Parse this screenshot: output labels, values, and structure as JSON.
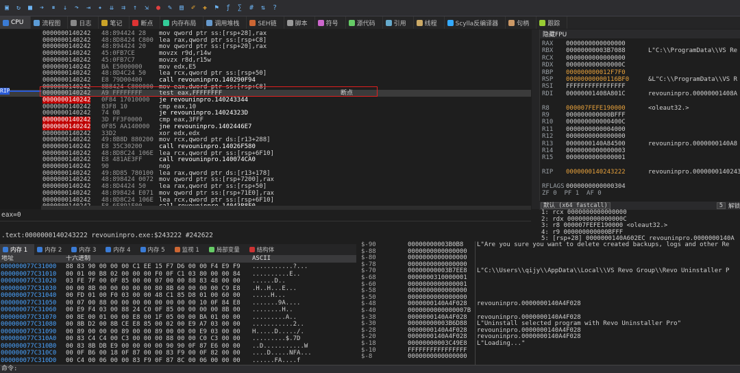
{
  "toolbar": {
    "icons": [
      "open-icon",
      "restart-icon",
      "close-icon",
      "run-icon",
      "pause-icon",
      "step-into-icon",
      "step-over-icon",
      "run-to-user-icon",
      "animate-icon",
      "trace-into-icon",
      "trace-over-icon",
      "step-out-icon",
      "run-to-selection-icon",
      "breakpoint-icon",
      "patch-icon",
      "memory-icon",
      "comment-icon",
      "label-icon",
      "bookmark-icon",
      "function-icon",
      "calc-icon",
      "hash-icon",
      "sort-icon",
      "help-icon"
    ]
  },
  "tabs": [
    {
      "label": "CPU",
      "color": "#3a7bd5"
    },
    {
      "label": "流程图",
      "color": "#5b9bd5"
    },
    {
      "label": "日志",
      "color": "#888"
    },
    {
      "label": "笔记",
      "color": "#c9a227"
    },
    {
      "label": "断点",
      "color": "#d33"
    },
    {
      "label": "内存布局",
      "color": "#3c9"
    },
    {
      "label": "调用堆栈",
      "color": "#69c"
    },
    {
      "label": "SEH链",
      "color": "#c63"
    },
    {
      "label": "脚本",
      "color": "#999"
    },
    {
      "label": "符号",
      "color": "#c6c"
    },
    {
      "label": "源代码",
      "color": "#6c6"
    },
    {
      "label": "引用",
      "color": "#6ac"
    },
    {
      "label": "线程",
      "color": "#ca6"
    },
    {
      "label": "Scylla反编译器",
      "color": "#3af"
    },
    {
      "label": "句柄",
      "color": "#c96"
    },
    {
      "label": "跟踪",
      "color": "#9c3"
    }
  ],
  "cpu": {
    "rows": [
      {
        "addr": "0000000140242",
        "bytes": "48:894424 28",
        "ins": "mov qword ptr ss:[rsp+28],rax",
        "com": ""
      },
      {
        "addr": "0000000140242",
        "bytes": "48:8D8424 C800",
        "ins": "lea rax,qword ptr ss:[rsp+C8]",
        "com": ""
      },
      {
        "addr": "0000000140242",
        "bytes": "48:894424 20",
        "ins": "mov qword ptr ss:[rsp+20],rax",
        "com": ""
      },
      {
        "addr": "0000000140242",
        "bytes": "45:0FB7CE",
        "ins": "movzx r9d,r14w",
        "com": ""
      },
      {
        "addr": "0000000140242",
        "bytes": "45:0FB7C7",
        "ins": "movzx r8d,r15w",
        "com": ""
      },
      {
        "addr": "0000000140242",
        "bytes": "BA E5000000",
        "ins": "mov edx,E5",
        "com": ""
      },
      {
        "addr": "0000000140242",
        "bytes": "48:8D4C24 50",
        "ins": "lea rcx,qword ptr ss:[rsp+50]",
        "com": ""
      },
      {
        "addr": "0000000140242",
        "bytes": "E8 79D00400",
        "ins": "call revouninpro.140290F94",
        "com": ""
      },
      {
        "addr": "0000000140242",
        "bytes": "8B8424 C800000",
        "ins": "mov eax,dword ptr ss:[rsp+C8]",
        "com": ""
      },
      {
        "addr": "0000000140242",
        "bytes": "A9 FFFFFFFF",
        "ins": "test eax,FFFFFFFF",
        "com": "断点"
      },
      {
        "addr": "0000000140242",
        "bytes": "0F84 17010000",
        "ins": "je revouninpro.140243344",
        "com": ""
      },
      {
        "addr": "0000000140242",
        "bytes": "83F8 10",
        "ins": "cmp eax,10",
        "com": ""
      },
      {
        "addr": "0000000140242",
        "bytes": "74 0B",
        "ins": "je revouninpro.14024323D",
        "com": ""
      },
      {
        "addr": "0000000140242",
        "bytes": "3D FF3F0000",
        "ins": "cmp eax,3FFF",
        "com": ""
      },
      {
        "addr": "0000000140242",
        "bytes": "0F85 AA140000",
        "ins": "jne revouninpro.1402446E7",
        "com": ""
      },
      {
        "addr": "0000000140242",
        "bytes": "33D2",
        "ins": "xor edx,edx",
        "com": ""
      },
      {
        "addr": "0000000140242",
        "bytes": "49:8B8D 880200",
        "ins": "mov rcx,qword ptr ds:[r13+288]",
        "com": ""
      },
      {
        "addr": "0000000140242",
        "bytes": "E8 35C30200",
        "ins": "call revouninpro.14026F580",
        "com": ""
      },
      {
        "addr": "0000000140242",
        "bytes": "48:8D8C24 106E",
        "ins": "lea rcx,qword ptr ss:[rsp+6F10]",
        "com": ""
      },
      {
        "addr": "0000000140242",
        "bytes": "E8 481AE3FF",
        "ins": "call revouninpro.140074CA0",
        "com": ""
      },
      {
        "addr": "0000000140242",
        "bytes": "90",
        "ins": "nop",
        "com": ""
      },
      {
        "addr": "0000000140242",
        "bytes": "49:8D85 780100",
        "ins": "lea rax,qword ptr ds:[r13+178]",
        "com": ""
      },
      {
        "addr": "0000000140242",
        "bytes": "48:898424 0072",
        "ins": "mov qword ptr ss:[rsp+7200],rax",
        "com": ""
      },
      {
        "addr": "0000000140242",
        "bytes": "48:8D4424 50",
        "ins": "lea rax,qword ptr ss:[rsp+50]",
        "com": ""
      },
      {
        "addr": "0000000140242",
        "bytes": "48:898424 E071",
        "ins": "mov qword ptr ss:[rsp+71E0],rax",
        "com": ""
      },
      {
        "addr": "0000000140242",
        "bytes": "48:8D8C24 106E",
        "ins": "lea rcx,qword ptr ss:[rsp+6F10]",
        "com": ""
      },
      {
        "addr": "0000000140242",
        "bytes": "E8 6E891F00",
        "ins": "call revouninpro.14043B8F0",
        "com": ""
      }
    ],
    "rip_label": "RIP",
    "eax_line": "eax=0",
    "info_line": ".text:0000000140243222 revouninpro.exe:$243222 #242622"
  },
  "registers": {
    "title": "隐藏FPU",
    "rows": [
      {
        "n": "RAX",
        "v": "0000000000000000",
        "c": ""
      },
      {
        "n": "RBX",
        "v": "00000000003B7088",
        "c": "L\"C:\\\\ProgramData\\\\VS Re"
      },
      {
        "n": "RCX",
        "v": "0000000000000000",
        "c": ""
      },
      {
        "n": "RDX",
        "v": "000000000000000C",
        "c": ""
      },
      {
        "n": "RBP",
        "v": "000000000012F7F0",
        "c": ""
      },
      {
        "n": "RSP",
        "v": "00000000000116BF0",
        "c": "&L\"C:\\\\ProgramData\\\\VS R"
      },
      {
        "n": "RSI",
        "v": "FFFFFFFFFFFFFFFF",
        "c": ""
      },
      {
        "n": "RDI",
        "v": "00000001408A801C",
        "c": "revouninpro.0000000140​8A"
      },
      {
        "n": "",
        "v": "",
        "c": ""
      },
      {
        "n": "R8",
        "v": "000007FEFE190000",
        "c": "<oleaut32.>"
      },
      {
        "n": "R9",
        "v": "000000000000BFFF",
        "c": ""
      },
      {
        "n": "R10",
        "v": "000000000000400C",
        "c": ""
      },
      {
        "n": "R11",
        "v": "0000000000004000",
        "c": ""
      },
      {
        "n": "R12",
        "v": "0000000000000000",
        "c": ""
      },
      {
        "n": "R13",
        "v": "0000000140A84500",
        "c": "revouninpro.0000000140A8"
      },
      {
        "n": "R14",
        "v": "0000000000000003",
        "c": ""
      },
      {
        "n": "R15",
        "v": "0000000000000001",
        "c": ""
      },
      {
        "n": "",
        "v": "",
        "c": ""
      },
      {
        "n": "RIP",
        "v": "0000000140243222",
        "c": "revouninpro.0000000140243"
      },
      {
        "n": "",
        "v": "",
        "c": ""
      },
      {
        "n": "RFLAGS",
        "v": "0000000000000304",
        "c": ""
      },
      {
        "n": "ZF 0  PF 1  AF 0",
        "v": "",
        "c": ""
      }
    ]
  },
  "callstack": {
    "conv": "默认 (x64 fastcall)",
    "count": "5",
    "unlock": "解锁",
    "rows": [
      "1: rcx 0000000000000000",
      "2: rdx 000000000000000C",
      "3: r8 000007FEFE190000 <oleaut32.>",
      "4: r9 000000000000BFFF",
      "5: [rsp+28] 0000000140A602EC revouninpro.0000000140A"
    ]
  },
  "bottom_tabs": [
    "内存 1",
    "内存 2",
    "内存 3",
    "内存 4",
    "内存 5",
    "监视 1",
    "局部变量",
    "结构体"
  ],
  "dump": {
    "headers": {
      "addr": "地址",
      "hex": "十六进制",
      "ascii": "ASCII"
    },
    "rows": [
      {
        "a": "000000077C31000",
        "h": "88 83 90 00 00 00 C1 EE 15 F7 D6 00 00 F4 E9 F9",
        "s": "...........?..."
      },
      {
        "a": "000000077C31010",
        "h": "00 01 00 B8 02 00 00 00 F0 0F C1 03 80 00 00 84",
        "s": "..........E.."
      },
      {
        "a": "000000077C31020",
        "h": "03 FE 7F 00 0F 85 00 00 07 00 00 88 83 48 00 00",
        "s": "......D.."
      },
      {
        "a": "000000077C31030",
        "h": "00 00 8B 00 00 00 00 00 80 8B 60 00 00 00 C9 E8",
        "s": ".H..H...E..."
      },
      {
        "a": "000000077C31040",
        "h": "00 FD 01 00 F0 03 00 00 48 C1 85 D8 01 00 60 00",
        "s": ".....H..."
      },
      {
        "a": "000000077C31050",
        "h": "00 07 00 88 00 00 00 00 00 00 00 00 10 0F 84 E8",
        "s": ".......9A...."
      },
      {
        "a": "000000077C31060",
        "h": "00 E9 F4 03 00 88 24 C0 0F 85 00 00 00 00 8B 00",
        "s": "........H.."
      },
      {
        "a": "000000077C31070",
        "h": "00 8E 00 01 00 00 E8 00 1F 05 00 00 BA 01 00 00",
        "s": ".........A.."
      },
      {
        "a": "000000077C31080",
        "h": "00 8B D2 00 8B CE E8 85 00 02 00 E9 A7 03 00 00",
        "s": "...........2.."
      },
      {
        "a": "000000077C31090",
        "h": "00 89 00 00 00 89 00 00 89 00 00 00 E9 03 00 00",
        "s": "H.....D...../."
      },
      {
        "a": "000000077C310A0",
        "h": "00 83 C4 C4 00 C3 00 00 00 88 00 00 C0 C3 00 00",
        "s": ".........$.7D"
      },
      {
        "a": "000000077C310B0",
        "h": "00 83 8B DB E9 00 00 00 00 90 90 0F 87 E6 00 00",
        "s": "..D...........W"
      },
      {
        "a": "000000077C310C0",
        "h": "00 0F B6 00 18 0F 87 00 00 83 F9 00 0F 82 00 00",
        "s": "....D.....NFA..."
      },
      {
        "a": "000000077C310D0",
        "h": "00 C4 00 06 00 00 83 F9 0F 87 8C 00 06 00 00 00",
        "s": "......FA....f"
      }
    ]
  },
  "stack": {
    "rows": [
      {
        "o": "$-90",
        "v": "00000000003B0B8",
        "c": "L\"Are you sure you want to delete created backups, logs and other Re"
      },
      {
        "o": "$-88",
        "v": "0000000000000000",
        "c": ""
      },
      {
        "o": "$-80",
        "v": "0000000000000000",
        "c": ""
      },
      {
        "o": "$-78",
        "v": "0000000000000000",
        "c": ""
      },
      {
        "o": "$-70",
        "v": "00000000003B7EE8",
        "c": "L\"C:\\\\Users\\\\qijy\\\\AppData\\\\Local\\\\VS Revo Group\\\\Revo Uninstaller P"
      },
      {
        "o": "$-68",
        "v": "0000000310000001",
        "c": ""
      },
      {
        "o": "$-60",
        "v": "0000000000000001",
        "c": ""
      },
      {
        "o": "$-58",
        "v": "0000000000000000",
        "c": ""
      },
      {
        "o": "$-50",
        "v": "0000000000000000",
        "c": ""
      },
      {
        "o": "$-48",
        "v": "0000000140A4F028",
        "c": "revouninpro.0000000140A4F028"
      },
      {
        "o": "$-40",
        "v": "0000000000000007B",
        "c": ""
      },
      {
        "o": "$-38",
        "v": "0000000140A4F028",
        "c": "revouninpro.0000000140A4F028"
      },
      {
        "o": "$-30",
        "v": "00000000003B6D88",
        "c": "L\"Uninstall selected program with Revo Uninstaller Pro\""
      },
      {
        "o": "$-28",
        "v": "0000000140A4F028",
        "c": "revouninpro.0000000140A4F028"
      },
      {
        "o": "$-20",
        "v": "0000000140A4F028",
        "c": "revouninpro.0000000140A4F028"
      },
      {
        "o": "$-18",
        "v": "00000000003C49E8",
        "c": "L\"Loading...\""
      },
      {
        "o": "$-10",
        "v": "FFFFFFFFFFFFFFFF",
        "c": ""
      },
      {
        "o": "$-8",
        "v": "0000000000000000",
        "c": ""
      }
    ]
  },
  "cmdbar": {
    "label": "命令:"
  }
}
